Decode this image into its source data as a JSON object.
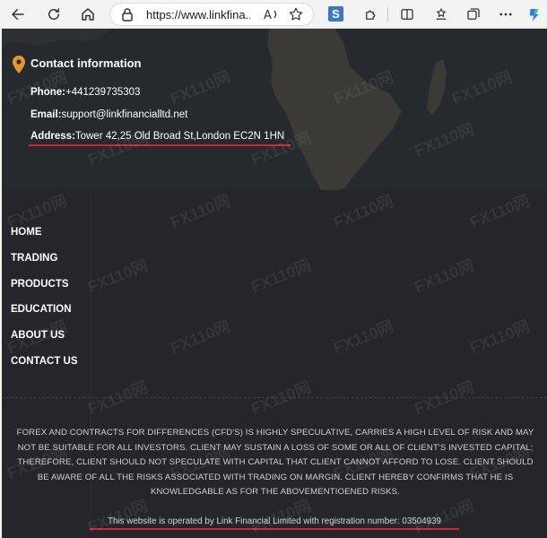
{
  "browser": {
    "url": "https://www.linkfina...",
    "extension_letter": "S"
  },
  "contact": {
    "title": "Contact information",
    "phone_label": "Phone:",
    "phone_value": "+441239735303",
    "email_label": "Email:",
    "email_value": "support@linkfinancialltd.net",
    "address_label": "Address:",
    "address_value": "Tower 42,25 Old Broad St,London EC2N 1HN"
  },
  "nav": {
    "items": [
      "HOME",
      "TRADING",
      "PRODUCTS",
      "EDUCATION",
      "ABOUT US",
      "CONTACT US"
    ]
  },
  "footer": {
    "disclaimer": "FOREX AND CONTRACTS FOR DIFFERENCES (CFD'S) IS HIGHLY SPECULATIVE, CARRIES A HIGH LEVEL OF RISK AND MAY NOT BE SUITABLE FOR ALL INVESTORS. CLIENT MAY SUSTAIN A LOSS OF SOME OR ALL OF CLIENT'S INVESTED CAPITAL; THEREFORE, CLIENT SHOULD NOT SPECULATE WITH CAPITAL THAT CLIENT CANNOT AFFORD TO LOSE. CLIENT SHOULD BE AWARE OF ALL THE RISKS ASSOCIATED WITH TRADING ON MARGIN. CLIENT HEREBY CONFIRMS THAT HE IS KNOWLEDGABLE AS FOR THE ABOVEMENTIOENED RISKS.",
    "operated": "This website is operated by Link Financial Limited with registration number: 03504939"
  },
  "watermark": "FX110网",
  "colors": {
    "page_bg": "#24262b",
    "accent_pin": "#e8952a",
    "underline": "#d8252d"
  }
}
